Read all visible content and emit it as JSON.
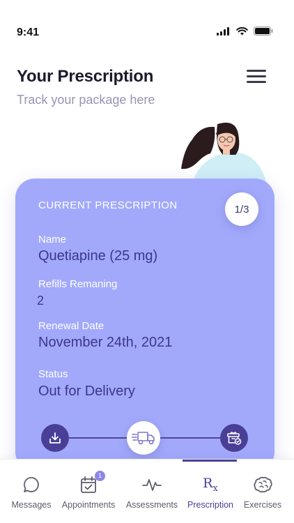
{
  "status_bar": {
    "time": "9:41"
  },
  "header": {
    "title": "Your Prescription",
    "subtitle": "Track your package here"
  },
  "card": {
    "heading": "CURRENT PRESCRIPTION",
    "counter": "1/3",
    "fields": {
      "name_label": "Name",
      "name_value": "Quetiapine (25 mg)",
      "refills_label": "Refills Remaning",
      "refills_value": "2",
      "renewal_label": "Renewal Date",
      "renewal_value": "November 24th, 2021",
      "status_label": "Status",
      "status_value": "Out for Delivery"
    },
    "tracker": {
      "steps": [
        "download-icon",
        "delivery-truck-icon",
        "package-delivered-icon"
      ],
      "current_step": 2
    }
  },
  "tab_bar": {
    "active": "Prescription",
    "tabs": [
      {
        "label": "Messages",
        "icon": "chat-bubble-icon"
      },
      {
        "label": "Appointments",
        "icon": "calendar-check-icon",
        "badge": "1"
      },
      {
        "label": "Assessments",
        "icon": "pulse-icon"
      },
      {
        "label": "Prescription",
        "icon": "rx-icon"
      },
      {
        "label": "Exercises",
        "icon": "brain-icon"
      }
    ]
  },
  "colors": {
    "card": "#a2a9fb",
    "accent": "#4a3f97",
    "value_text": "#3d3787",
    "subtitle": "#9794b5"
  }
}
